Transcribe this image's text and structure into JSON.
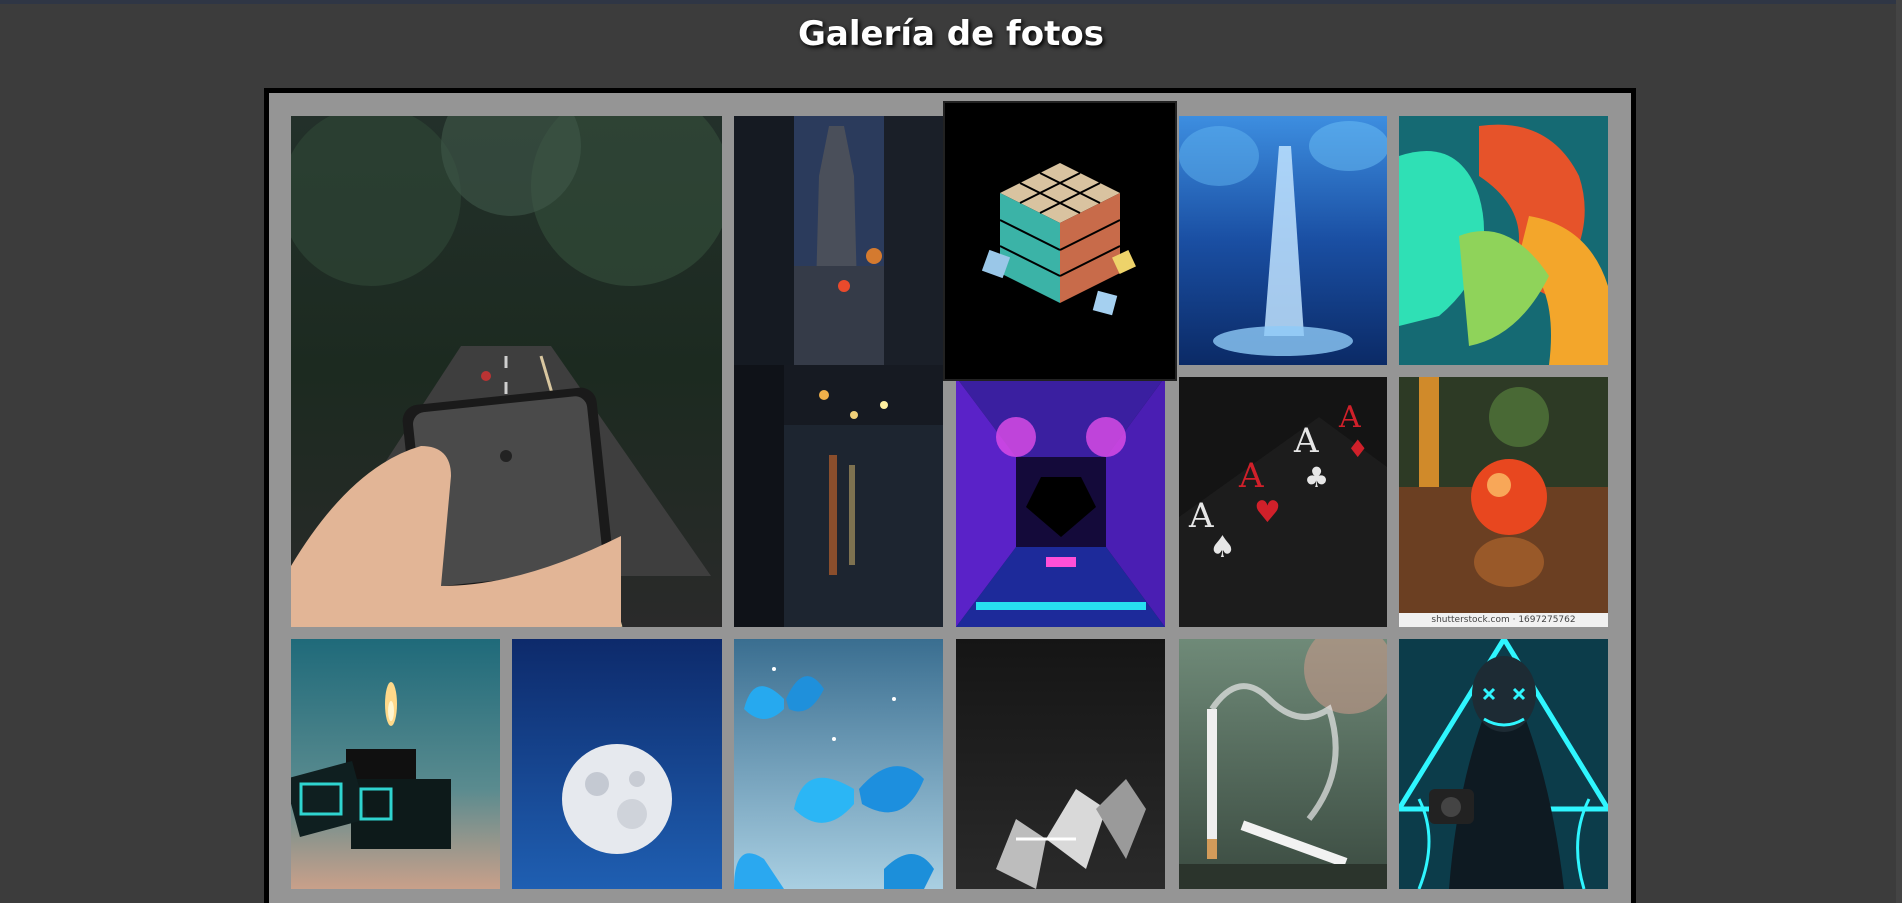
{
  "page": {
    "title": "Galería de fotos"
  },
  "photos": [
    {
      "name": "road-phone-photo",
      "alt": "Carretera en el bosque vista a través de un teléfono"
    },
    {
      "name": "city-rain-photo",
      "alt": "Calle de ciudad con lluvia y torre"
    },
    {
      "name": "rubiks-cube-photo",
      "alt": "Cubo de Rubik artístico"
    },
    {
      "name": "water-fountain-photo",
      "alt": "Fuente de agua azul"
    },
    {
      "name": "color-ribbons-photo",
      "alt": "Cintas de colores"
    },
    {
      "name": "neon-tunnel-photo",
      "alt": "Túnel de neón"
    },
    {
      "name": "aces-cards-photo",
      "alt": "Cartas de ases"
    },
    {
      "name": "marble-photo",
      "alt": "Canica de cristal",
      "caption": "shutterstock.com · 1697275762"
    },
    {
      "name": "lighter-photo",
      "alt": "Encendedor con llama"
    },
    {
      "name": "moon-photo",
      "alt": "Luna llena"
    },
    {
      "name": "butterflies-photo",
      "alt": "Mariposas azules"
    },
    {
      "name": "metal-letters-photo",
      "alt": "Letras metálicas"
    },
    {
      "name": "cigarette-photo",
      "alt": "Cigarro con humo"
    },
    {
      "name": "neon-mask-photo",
      "alt": "Persona con máscara de neón"
    }
  ],
  "colors": {
    "page_background": "#3c3c3c",
    "gallery_frame": "#000000",
    "gallery_background": "#959595",
    "title": "#ffffff"
  }
}
